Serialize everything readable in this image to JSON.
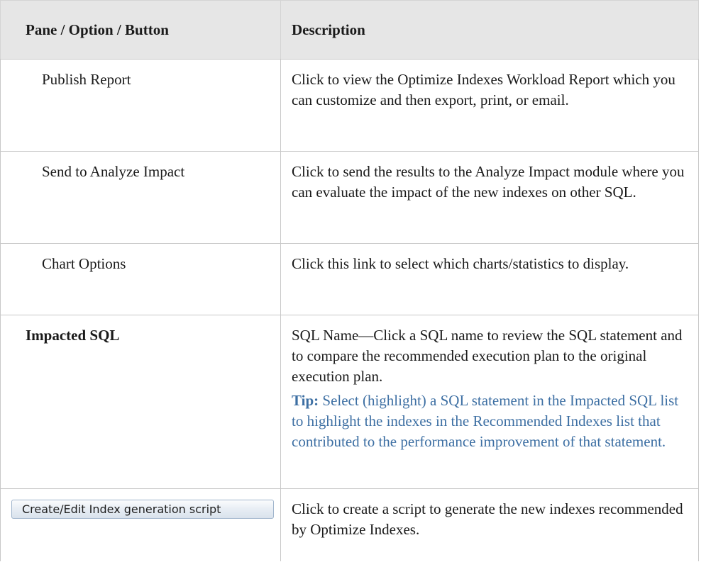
{
  "header": {
    "col1": "Pane / Option / Button",
    "col2": "Description"
  },
  "rows": [
    {
      "option": "Publish Report",
      "description": "Click to view the Optimize Indexes Workload Report which you can customize and then export, print, or email."
    },
    {
      "option": "Send to Analyze Impact",
      "description": "Click to send the results to the Analyze Impact module where you can evaluate the impact of the new indexes on other SQL."
    },
    {
      "option": "Chart Options",
      "description": "Click this link to select which charts/statistics to display."
    },
    {
      "option": "Impacted SQL",
      "description": "SQL Name—Click a SQL name to review the SQL statement and to compare the recommended execution plan to the original execution plan.",
      "tip_label": "Tip:",
      "tip_text": " Select (highlight) a SQL statement in the Impacted SQL list to highlight the indexes in the Recommended Indexes list that contributed to the performance improvement of that statement."
    },
    {
      "button_label": "Create/Edit Index generation script",
      "description": "Click to create a script to generate the new indexes recommended by Optimize Indexes."
    }
  ],
  "colors": {
    "tip": "#3d6fa3",
    "header_bg": "#e6e6e6",
    "border": "#c8c8c8"
  }
}
